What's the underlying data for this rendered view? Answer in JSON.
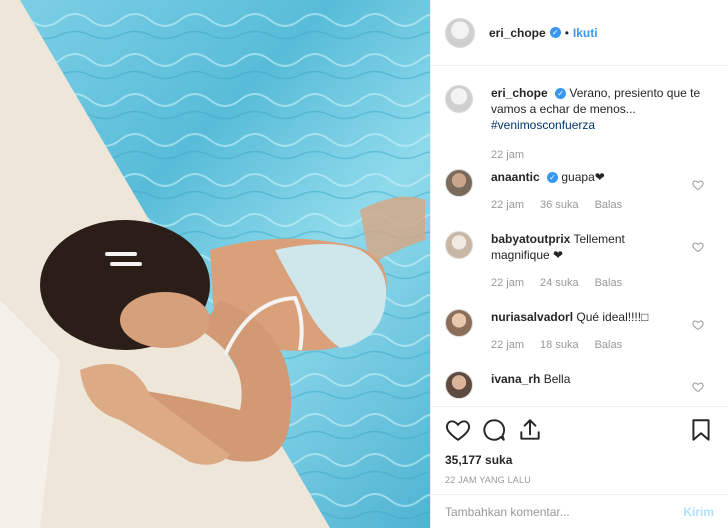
{
  "post": {
    "username": "eri_chope",
    "follow_label": "Ikuti",
    "dot": "•",
    "more": "..."
  },
  "caption": {
    "username": "eri_chope",
    "text": "Verano, presiento que te vamos a echar de menos...",
    "hashtag": "#venimosconfuerza",
    "time": "22 jam"
  },
  "comments": [
    {
      "username": "anaantic",
      "verified": true,
      "text": "guapa❤",
      "time": "22 jam",
      "likes": "36 suka",
      "reply": "Balas"
    },
    {
      "username": "babyatoutprix",
      "verified": false,
      "text": "Tellement magnifique ❤",
      "time": "22 jam",
      "likes": "24 suka",
      "reply": "Balas"
    },
    {
      "username": "nuriasalvadorl",
      "verified": false,
      "text": "Qué ideal!!!!□",
      "time": "22 jam",
      "likes": "18 suka",
      "reply": "Balas"
    },
    {
      "username": "ivana_rh",
      "verified": false,
      "text": "Bella",
      "time": "",
      "likes": "",
      "reply": ""
    }
  ],
  "stats": {
    "likes": "35,177 suka",
    "ago": "22 JAM YANG LALU"
  },
  "add_comment": {
    "placeholder": "Tambahkan komentar...",
    "post_label": "Kirim"
  },
  "icons": {
    "like": "heart-icon",
    "comment": "comment-icon",
    "share": "share-icon",
    "save": "bookmark-icon"
  },
  "colors": {
    "accent": "#3897f0",
    "water": "#58bcd8",
    "pool_edge": "#efe6da"
  }
}
